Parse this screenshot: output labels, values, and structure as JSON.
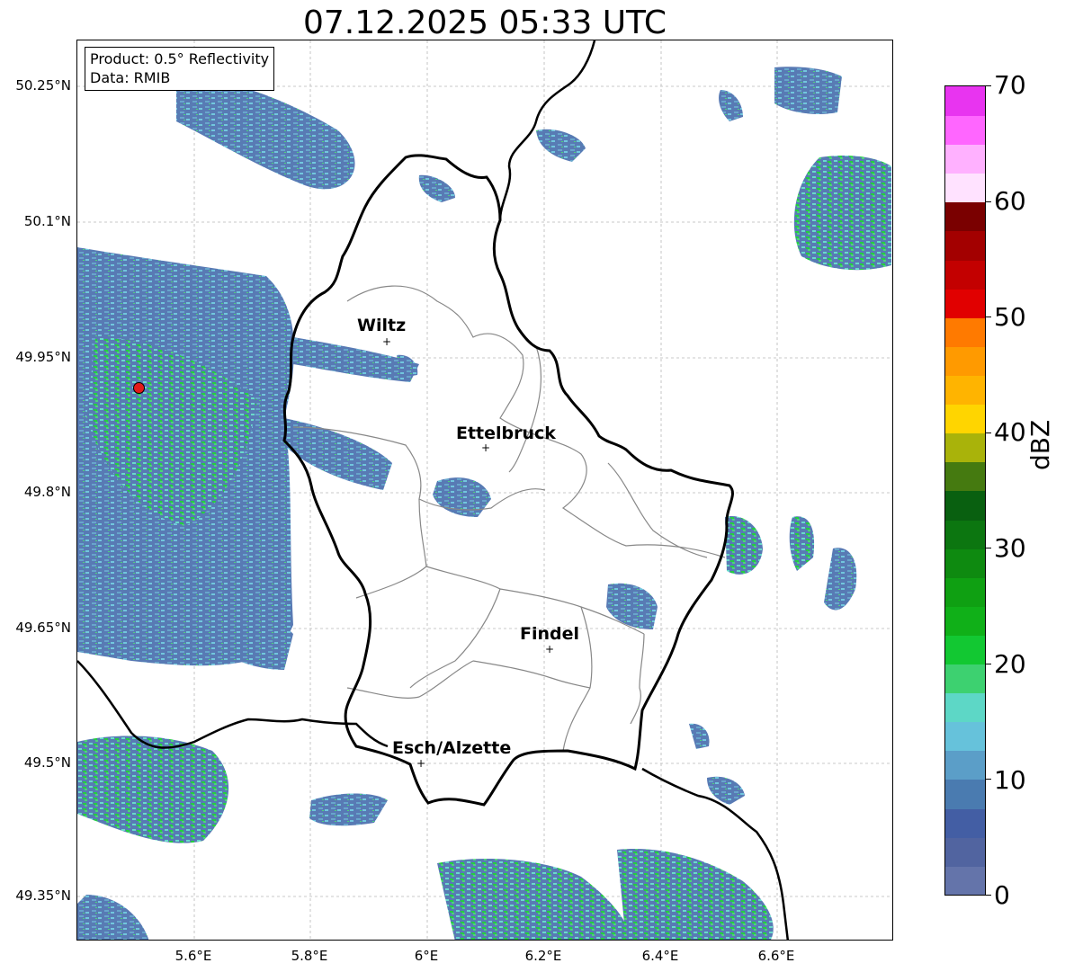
{
  "title": "07.12.2025 05:33 UTC",
  "info": {
    "product": "Product: 0.5° Reflectivity",
    "source": "Data: RMIB"
  },
  "lat_labels": [
    "50.25°N",
    "50.1°N",
    "49.95°N",
    "49.8°N",
    "49.65°N",
    "49.5°N",
    "49.35°N"
  ],
  "lon_labels": [
    "5.6°E",
    "5.8°E",
    "6°E",
    "6.2°E",
    "6.4°E",
    "6.6°E"
  ],
  "cities": [
    "Wiltz",
    "Ettelbruck",
    "Findel",
    "Esch/Alzette"
  ],
  "colorbar": {
    "unit": "dBZ",
    "tick_labels": [
      "0",
      "10",
      "20",
      "30",
      "40",
      "50",
      "60",
      "70"
    ],
    "colors": [
      "#6474aa",
      "#5164a0",
      "#435ea4",
      "#4a7bb0",
      "#5b9ec8",
      "#66c2db",
      "#5dd7c6",
      "#3dd170",
      "#12c832",
      "#10b018",
      "#0fa012",
      "#0e8a10",
      "#0c7610",
      "#096010",
      "#457a10",
      "#a9b30a",
      "#ffd500",
      "#ffb400",
      "#ff9a00",
      "#ff7a00",
      "#e10000",
      "#c30000",
      "#a30000",
      "#7a0000",
      "#ffe2ff",
      "#ffb1ff",
      "#ff66ff",
      "#e834f0"
    ]
  }
}
